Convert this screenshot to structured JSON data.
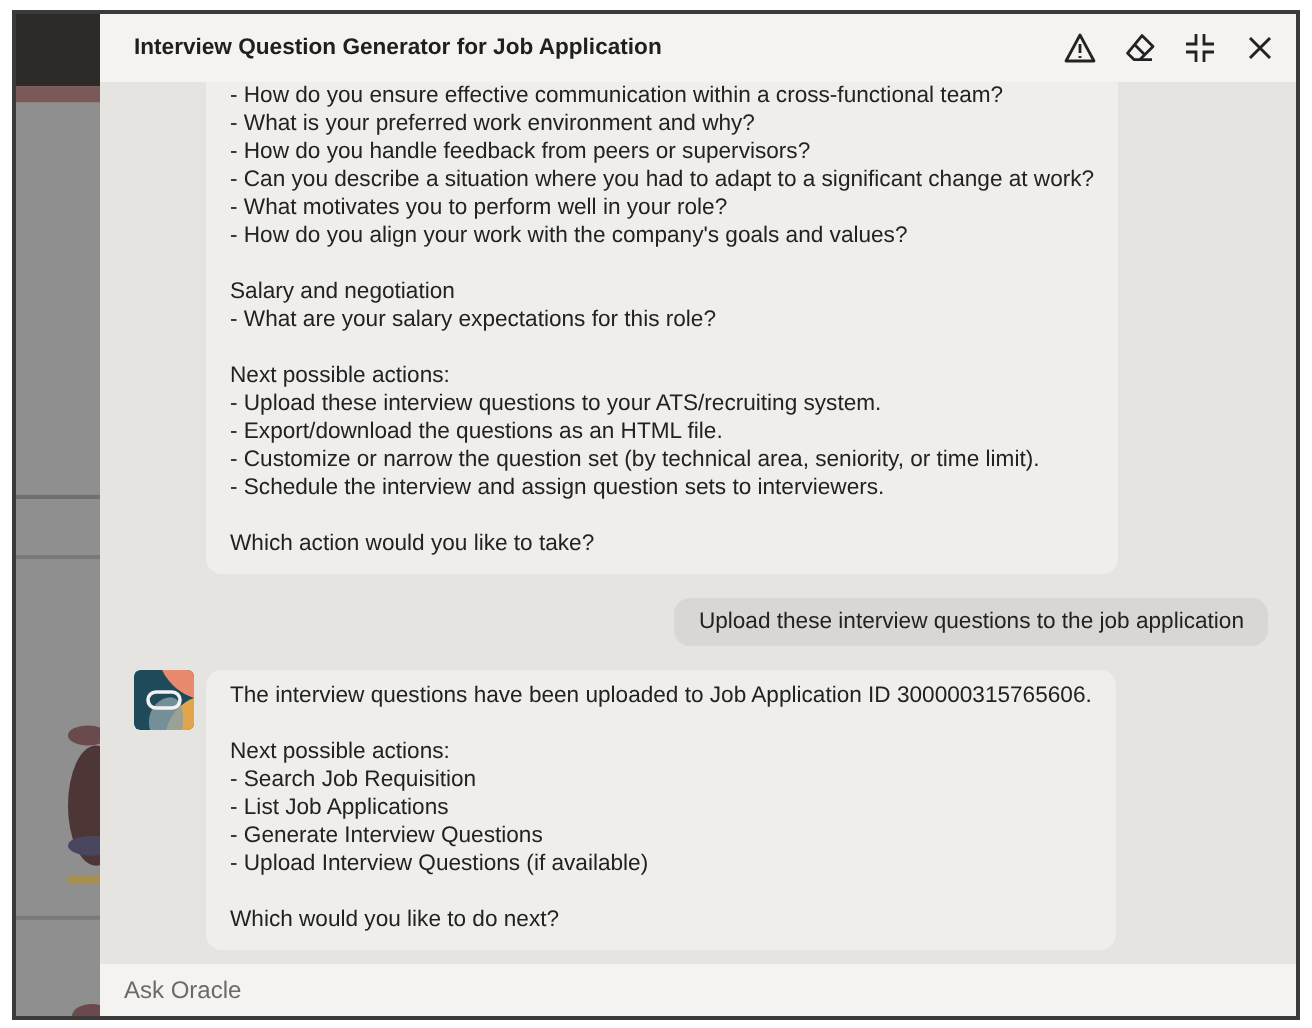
{
  "window": {
    "title": "Interview Question Generator for Job Application"
  },
  "messages": [
    {
      "kind": "bot",
      "avatar": false,
      "paragraphs": [
        "- How do you ensure effective communication within a cross-functional team?\n- What is your preferred work environment and why?\n- How do you handle feedback from peers or supervisors?\n- Can you describe a situation where you had to adapt to a significant change at work?\n- What motivates you to perform well in your role?\n- How do you align your work with the company's goals and values?",
        "Salary and negotiation\n- What are your salary expectations for this role?",
        "Next possible actions:\n- Upload these interview questions to your ATS/recruiting system.\n- Export/download the questions as an HTML file.\n- Customize or narrow the question set (by technical area, seniority, or time limit).\n- Schedule the interview and assign question sets to interviewers.",
        "Which action would you like to take?"
      ]
    },
    {
      "kind": "user",
      "paragraphs": [
        "Upload these interview questions to the job application"
      ]
    },
    {
      "kind": "bot",
      "avatar": true,
      "paragraphs": [
        "The interview questions have been uploaded to Job Application ID 300000315765606.",
        "Next possible actions:\n- Search Job Requisition\n- List Job Applications\n- Generate Interview Questions\n- Upload Interview Questions (if available)",
        "Which would you like to do next?"
      ]
    }
  ],
  "input": {
    "placeholder": "Ask Oracle"
  }
}
